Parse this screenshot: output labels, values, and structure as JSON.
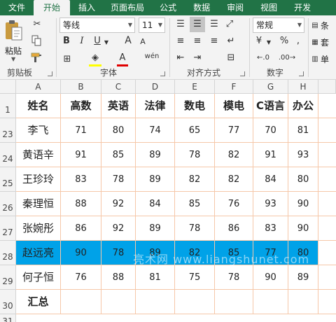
{
  "tabs": [
    "文件",
    "开始",
    "插入",
    "页面布局",
    "公式",
    "数据",
    "审阅",
    "视图",
    "开发"
  ],
  "ribbon": {
    "clipboard": {
      "label": "剪贴板",
      "paste": "粘贴"
    },
    "font": {
      "label": "字体",
      "name": "等线",
      "size": "11",
      "bold": "B",
      "italic": "I",
      "underline": "U",
      "grow": "A",
      "shrink": "A",
      "pinyin": "wén",
      "font_color_letter": "A"
    },
    "alignment": {
      "label": "对齐方式"
    },
    "number": {
      "label": "数字",
      "format": "常规",
      "currency": "¥",
      "percent": "%"
    },
    "cut_off": [
      "条",
      "套",
      "单"
    ]
  },
  "columns": [
    "A",
    "B",
    "C",
    "D",
    "E",
    "F",
    "G",
    "H"
  ],
  "header_row": {
    "num": "1",
    "cells": [
      "姓名",
      "高数",
      "英语",
      "法律",
      "数电",
      "模电",
      "C语言",
      "办公"
    ]
  },
  "rows": [
    {
      "num": "23",
      "cells": [
        "李飞",
        "71",
        "80",
        "74",
        "65",
        "77",
        "70",
        "81"
      ]
    },
    {
      "num": "24",
      "cells": [
        "黄语辛",
        "91",
        "85",
        "89",
        "78",
        "82",
        "91",
        "93"
      ]
    },
    {
      "num": "25",
      "cells": [
        "王珍玲",
        "83",
        "78",
        "89",
        "82",
        "82",
        "84",
        "80"
      ]
    },
    {
      "num": "26",
      "cells": [
        "秦理恒",
        "88",
        "92",
        "84",
        "85",
        "76",
        "93",
        "90"
      ]
    },
    {
      "num": "27",
      "cells": [
        "张婉彤",
        "86",
        "92",
        "89",
        "78",
        "86",
        "83",
        "90"
      ]
    },
    {
      "num": "28",
      "cells": [
        "赵远亮",
        "90",
        "78",
        "89",
        "82",
        "85",
        "77",
        "80"
      ],
      "highlight": true
    },
    {
      "num": "29",
      "cells": [
        "何子恒",
        "76",
        "88",
        "81",
        "75",
        "78",
        "90",
        "89"
      ]
    },
    {
      "num": "30",
      "cells": [
        "汇总",
        "",
        "",
        "",
        "",
        "",
        "",
        ""
      ]
    }
  ],
  "partial_row_num": "31",
  "watermark": "亮术网 www.liangshunet.com",
  "colors": {
    "accent": "#217346",
    "highlight": "#00a2e8",
    "border": "#f6c7a8"
  }
}
